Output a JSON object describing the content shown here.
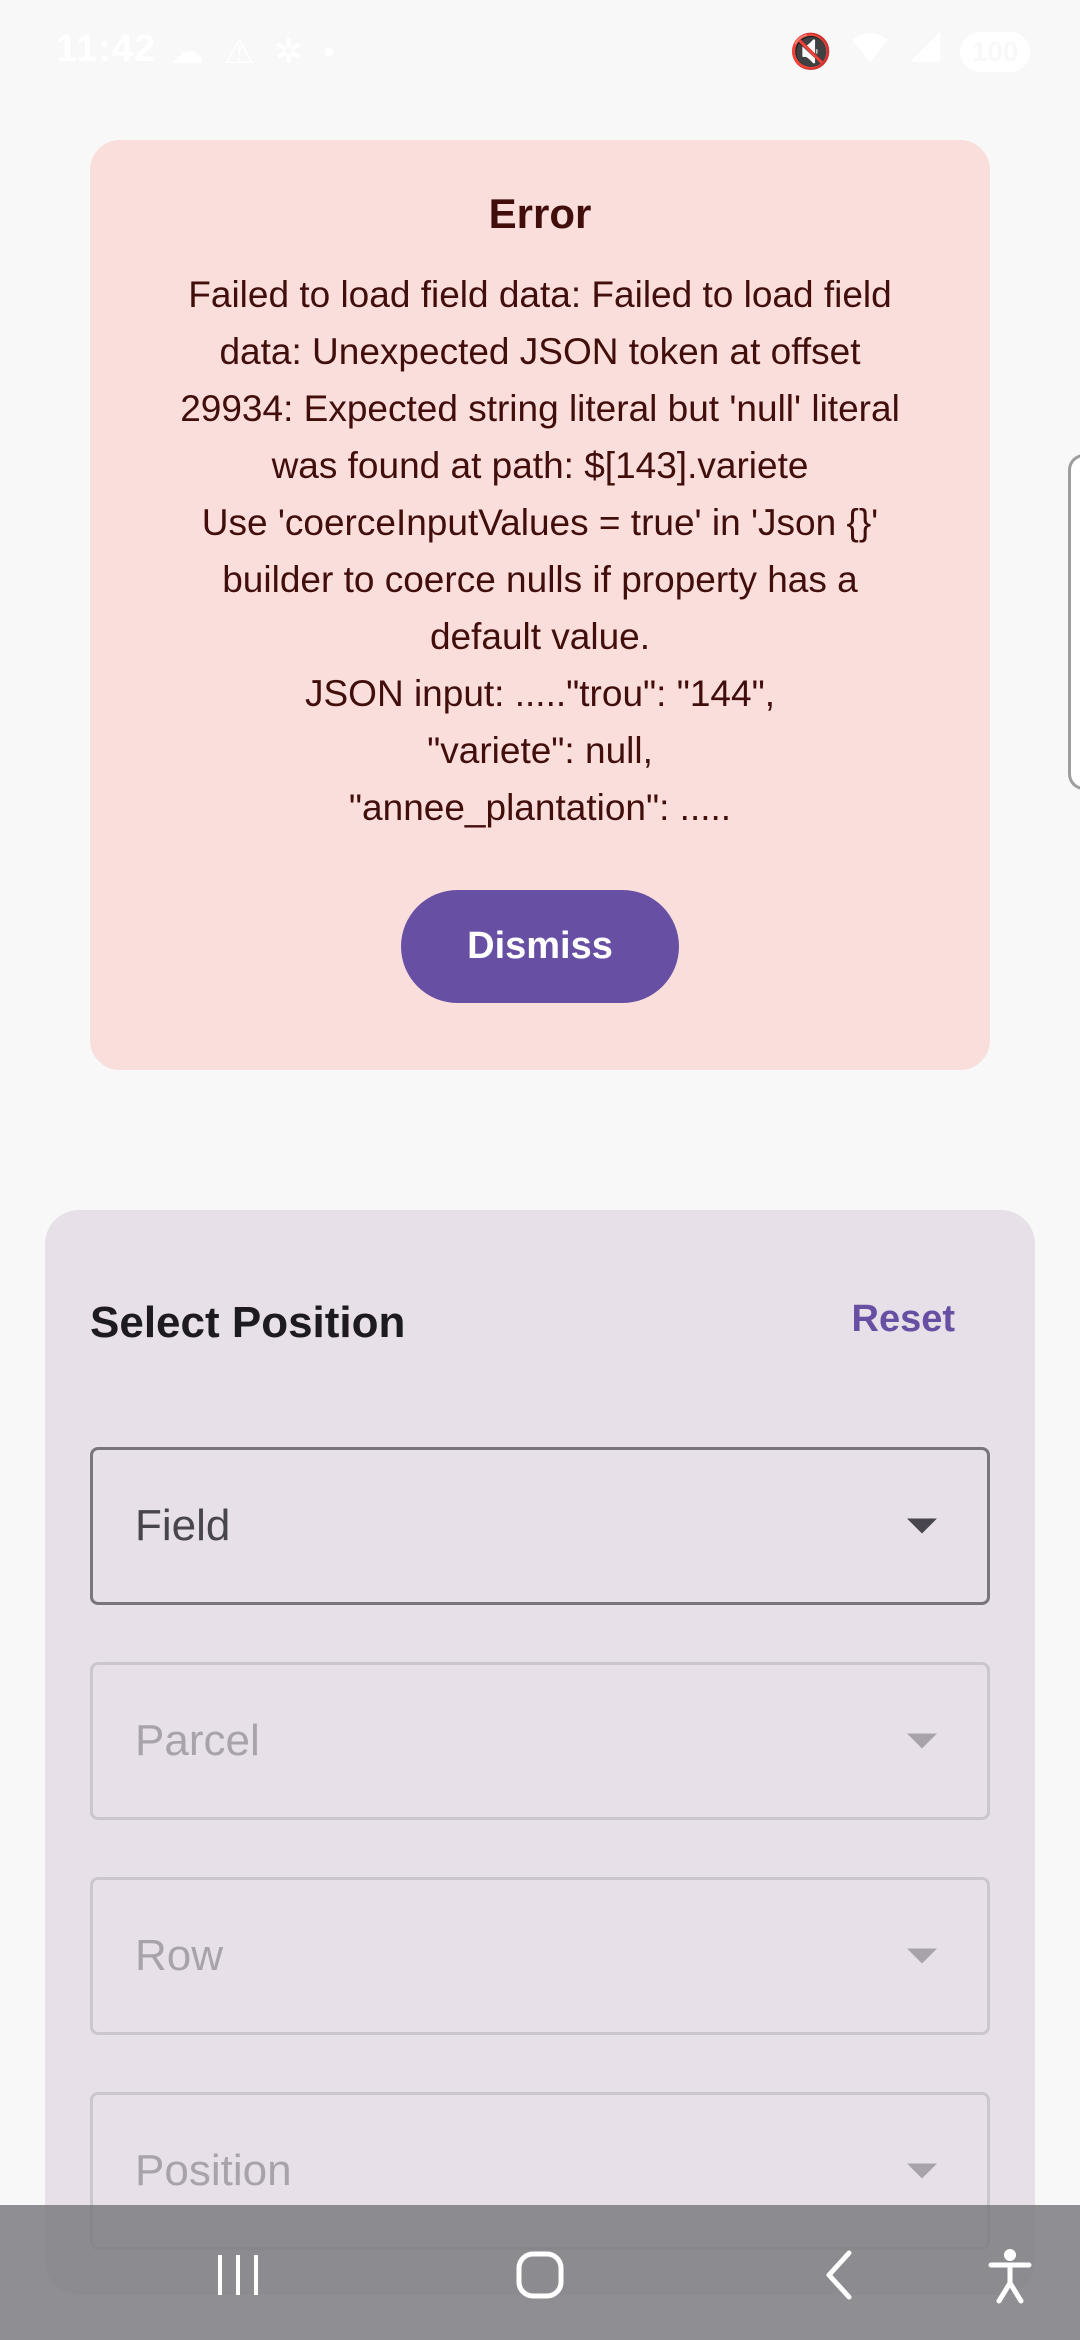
{
  "status_bar": {
    "time": "11:42",
    "battery": "100",
    "icons_left": [
      "cloud-icon",
      "warning-icon",
      "accessibility-icon",
      "dot-icon"
    ],
    "icons_right": [
      "mute-icon",
      "wifi-icon",
      "signal-icon"
    ]
  },
  "error": {
    "title": "Error",
    "lines": [
      "Failed to load field data: Failed to load field",
      "data: Unexpected JSON token at offset",
      "29934: Expected string literal but 'null' literal",
      "was found at path: $[143].variete",
      "Use 'coerceInputValues = true' in 'Json {}'",
      "builder to coerce nulls if property has a",
      "default value.",
      "JSON input: .....\"trou\": \"144\",",
      "\"variete\": null,",
      "\"annee_plantation\": ....."
    ],
    "dismiss_label": "Dismiss"
  },
  "panel": {
    "title": "Select Position",
    "reset_label": "Reset",
    "dropdowns": [
      {
        "label": "Field",
        "enabled": true
      },
      {
        "label": "Parcel",
        "enabled": false
      },
      {
        "label": "Row",
        "enabled": false
      },
      {
        "label": "Position",
        "enabled": false
      }
    ]
  },
  "colors": {
    "error_bg": "#f9dedc",
    "error_text": "#410e0b",
    "primary": "#6750a4",
    "panel_bg": "#e7e0e8"
  }
}
